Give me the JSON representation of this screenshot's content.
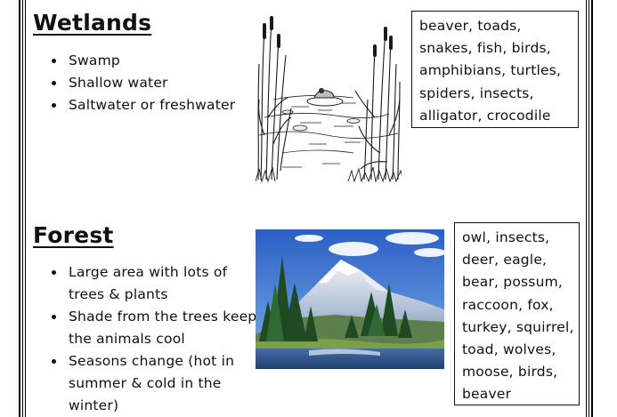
{
  "wetlands": {
    "title": "Wetlands",
    "bullets": [
      "Swamp",
      "Shallow water",
      "Saltwater or freshwater"
    ],
    "animals": "beaver, toads, snakes, fish, birds, amphibians, turtles, spiders, insects, alligator, crocodile"
  },
  "forest": {
    "title": "Forest",
    "bullets": [
      "Large area with lots of trees & plants",
      "Shade from the trees keep the animals cool",
      "Seasons change (hot in summer & cold in the winter)"
    ],
    "animals": "owl, insects, deer, eagle, bear, possum, raccoon, fox, turkey, squirrel, toad, wolves, moose, birds, beaver"
  }
}
